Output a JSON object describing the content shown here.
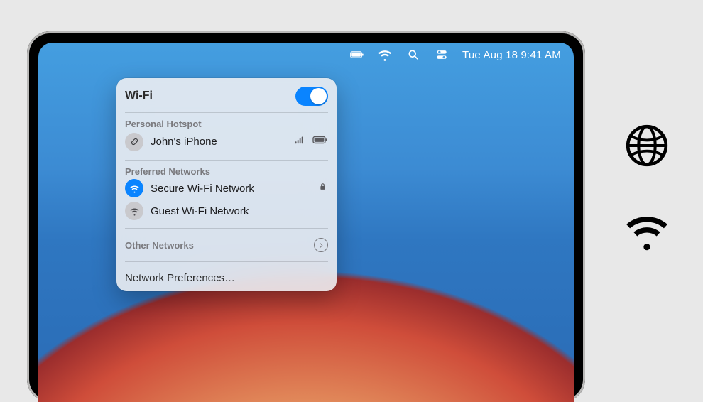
{
  "menubar": {
    "clock": "Tue Aug 18  9:41 AM",
    "icons": {
      "battery": "battery-icon",
      "wifi": "wifi-icon",
      "search": "search-icon",
      "control_center": "control-center-icon"
    }
  },
  "panel": {
    "title": "Wi-Fi",
    "wifi_enabled": true,
    "sections": {
      "personal_hotspot": {
        "label": "Personal Hotspot",
        "items": [
          {
            "icon": "link-icon",
            "name": "John's iPhone",
            "signal": "cellular-signal-icon",
            "battery": "battery-icon"
          }
        ]
      },
      "preferred": {
        "label": "Preferred Networks",
        "items": [
          {
            "icon": "wifi-icon",
            "name": "Secure Wi-Fi Network",
            "connected": true,
            "locked": true
          },
          {
            "icon": "wifi-icon",
            "name": "Guest Wi-Fi Network",
            "connected": false,
            "locked": false
          }
        ]
      },
      "other": {
        "label": "Other Networks"
      }
    },
    "preferences_label": "Network Preferences…"
  },
  "aside": {
    "globe": "globe-icon",
    "wifi": "wifi-icon"
  }
}
